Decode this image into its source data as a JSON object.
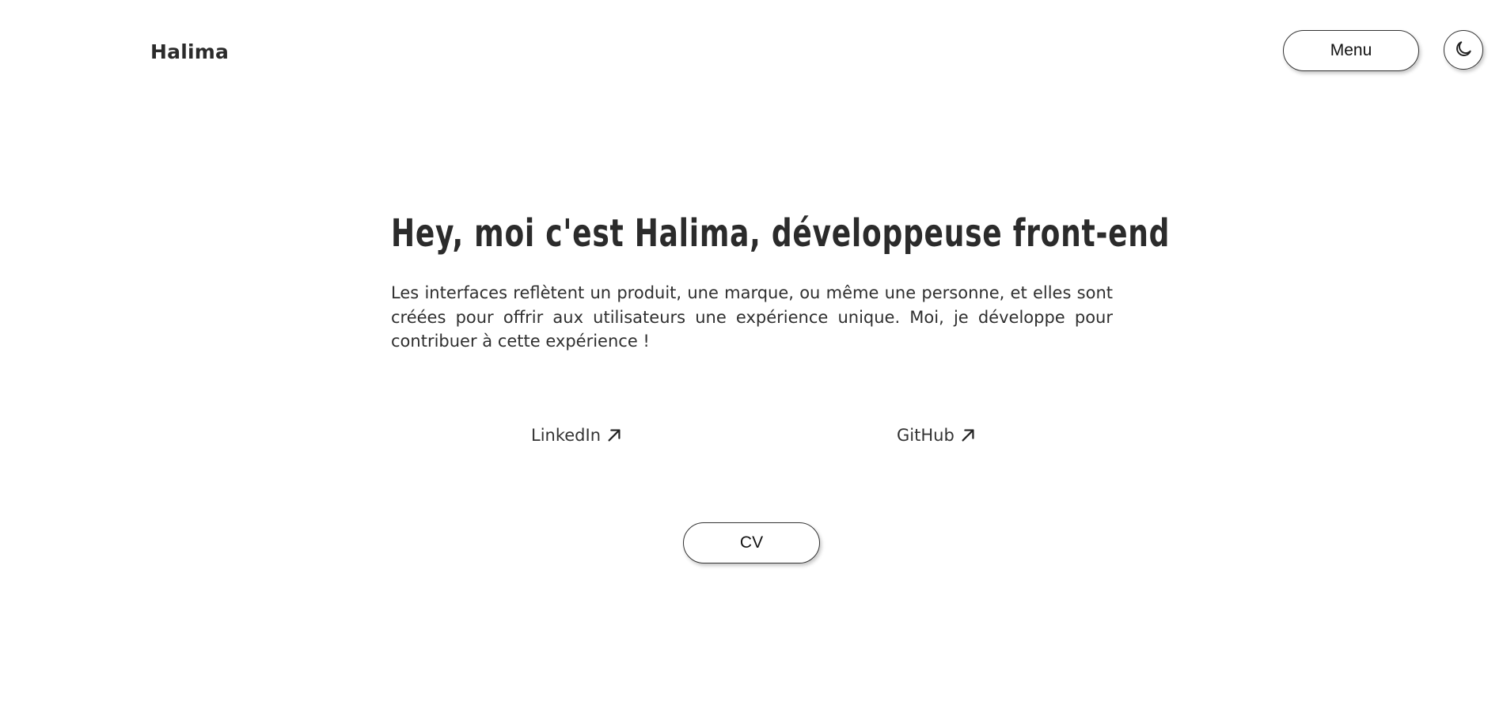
{
  "header": {
    "logo": "Halima",
    "menu_label": "Menu",
    "theme_toggle_icon": "moon-icon"
  },
  "hero": {
    "title": "Hey, moi c'est Halima, développeuse front-end",
    "description": "Les interfaces reflètent un produit, une marque, ou même une personne, et elles sont créées pour offrir aux utilisateurs une expérience unique. Moi, je développe pour contribuer à cette expérience !"
  },
  "links": {
    "linkedin": "LinkedIn",
    "github": "GitHub",
    "link_icon": "arrow-up-right-icon"
  },
  "cv_label": "CV",
  "colors": {
    "text": "#2b2b2b",
    "background": "#ffffff",
    "border": "#333333"
  }
}
